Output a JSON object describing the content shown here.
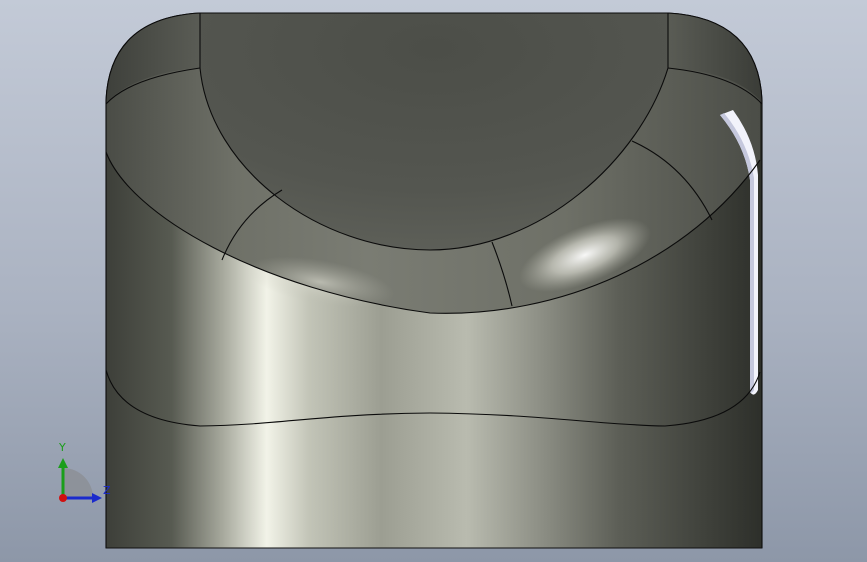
{
  "viewport": {
    "background_top": "#c2c9d6",
    "background_bottom": "#8f99aa",
    "part_color": "#5b5d55",
    "edge_color": "#0a0a0a"
  },
  "triad": {
    "y_label": "Y",
    "z_label": "Z",
    "y_color": "#1a9e1a",
    "z_color": "#1a2acc",
    "origin_color": "#d01010"
  }
}
